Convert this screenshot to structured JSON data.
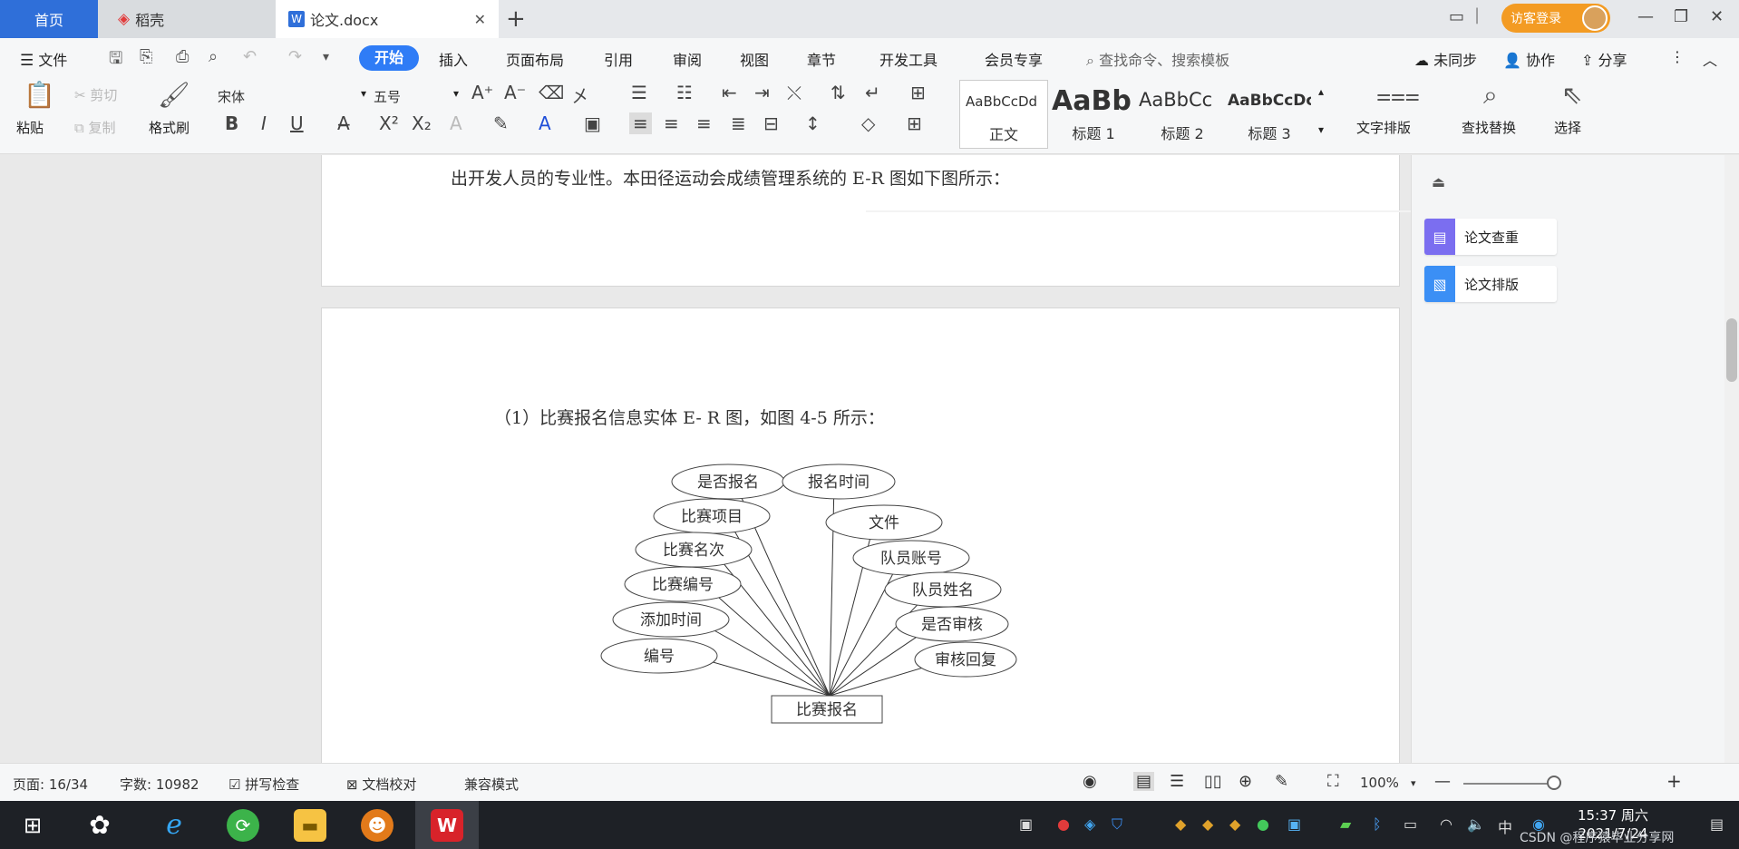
{
  "tabs": {
    "home": "首页",
    "daoke": "稻壳",
    "doc": "论文.docx",
    "add": "+"
  },
  "titlebar": {
    "visit_login": "访客登录"
  },
  "menu": {
    "file": "文件",
    "start": "开始",
    "insert": "插入",
    "layout": "页面布局",
    "reference": "引用",
    "review": "审阅",
    "view": "视图",
    "chapter": "章节",
    "devtools": "开发工具",
    "member": "会员专享",
    "search_placeholder": "查找命令、搜索模板",
    "unsynced": "未同步",
    "collaborate": "协作",
    "share": "分享"
  },
  "ribbon": {
    "paste": "粘贴",
    "cut": "剪切",
    "copy": "复制",
    "format_painter": "格式刷",
    "font_name": "宋体",
    "font_size": "五号",
    "bold": "B",
    "italic": "I",
    "underline": "U",
    "styles": [
      {
        "sample": "AaBbCcDd",
        "name": "正文"
      },
      {
        "sample": "AaBb",
        "name": "标题 1"
      },
      {
        "sample": "AaBbCc",
        "name": "标题 2"
      },
      {
        "sample": "AaBbCcDc",
        "name": "标题 3"
      }
    ],
    "text_layout": "文字排版",
    "find_replace": "查找替换",
    "select": "选择"
  },
  "document": {
    "para_top": "出开发人员的专业性。本田径运动会成绩管理系统的 E-R 图如下图所示：",
    "para_heading": "（1）比赛报名信息实体 E- R 图，如图 4-5 所示：",
    "er": {
      "entity": "比赛报名",
      "attributes": [
        "是否报名",
        "报名时间",
        "比赛项目",
        "文件",
        "比赛名次",
        "队员账号",
        "比赛编号",
        "队员姓名",
        "添加时间",
        "是否审核",
        "编号",
        "审核回复"
      ]
    }
  },
  "side_panel": {
    "check": "论文查重",
    "layout": "论文排版"
  },
  "statusbar": {
    "page": "页面: 16/34",
    "words": "字数: 10982",
    "spell": "拼写检查",
    "proof": "文档校对",
    "compat": "兼容模式",
    "zoom": "100%"
  },
  "taskbar": {
    "time": "15:37 周六",
    "date": "2021/7/24",
    "watermark": "CSDN @程序猿毕业分享网"
  }
}
